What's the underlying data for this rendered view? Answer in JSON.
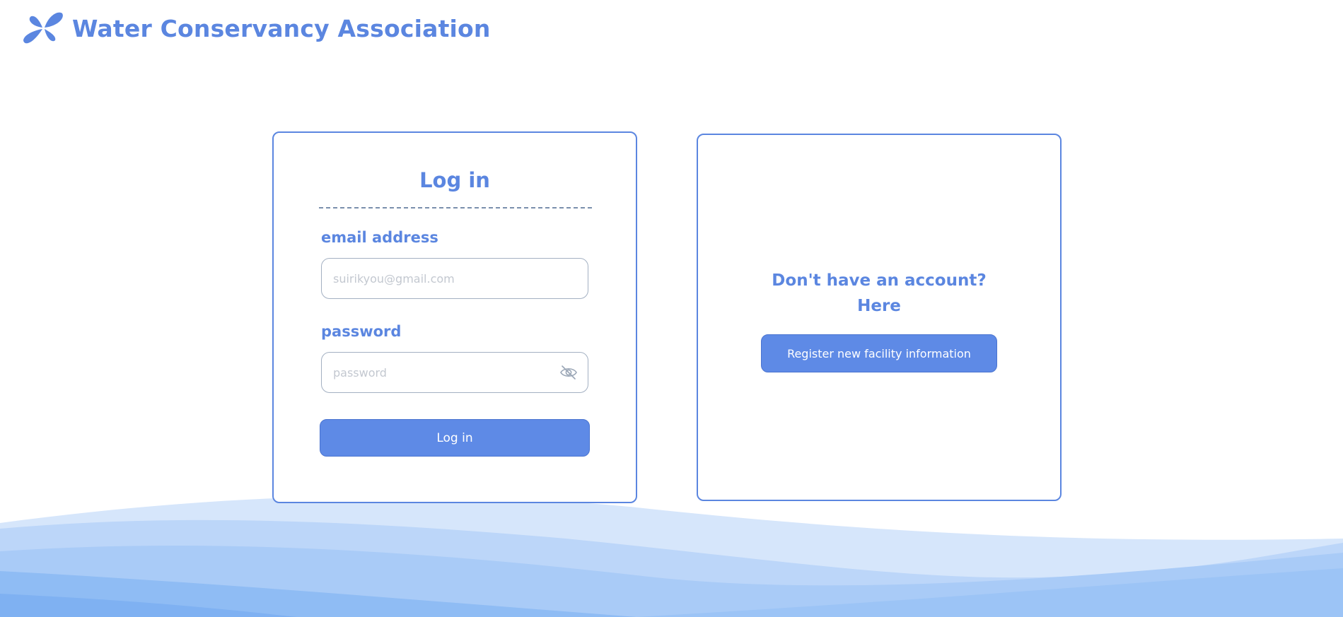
{
  "header": {
    "title": "Water Conservancy Association",
    "logo_icon": "water-drops-logo-icon"
  },
  "login": {
    "title": "Log in",
    "email_label": "email address",
    "email_placeholder": "suirikyou@gmail.com",
    "email_value": "",
    "password_label": "password",
    "password_placeholder": "password",
    "password_value": "",
    "password_toggle_icon": "eye-slash-icon",
    "submit_label": "Log in"
  },
  "register": {
    "prompt_line1": "Don't have an account?",
    "prompt_line2": "Here",
    "button_label": "Register new facility information"
  },
  "colors": {
    "accent": "#5b86e0",
    "button_bg": "#5e8ae6",
    "wave_light": "#d6e6fb",
    "wave_mid": "#a9cbf7",
    "wave_dark": "#7fb1f2"
  }
}
